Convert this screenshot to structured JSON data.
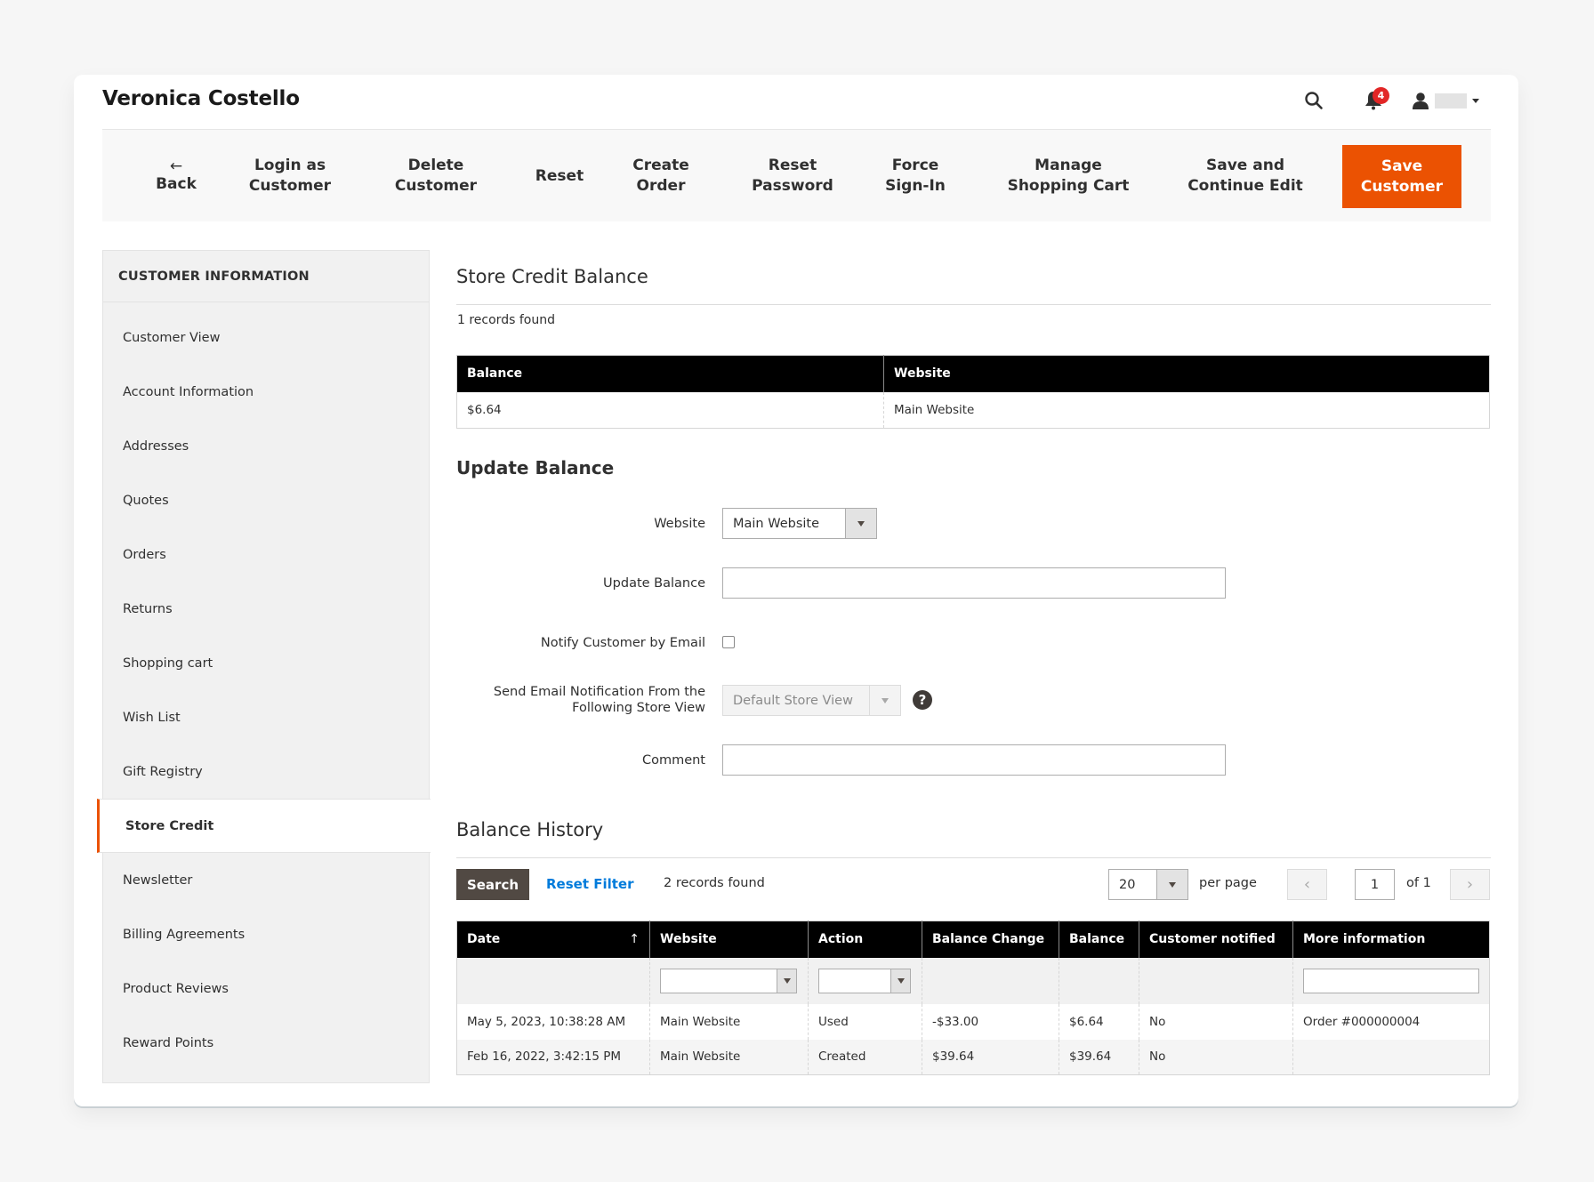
{
  "header": {
    "title": "Veronica Costello",
    "notification_count": "4"
  },
  "toolbar": {
    "back_icon": "←",
    "back_label": "Back",
    "buttons": [
      {
        "line1": "Login as",
        "line2": "Customer"
      },
      {
        "line1": "Delete",
        "line2": "Customer"
      },
      {
        "line1": "Reset",
        "line2": ""
      },
      {
        "line1": "Create",
        "line2": "Order"
      },
      {
        "line1": "Reset",
        "line2": "Password"
      },
      {
        "line1": "Force",
        "line2": "Sign-In"
      },
      {
        "line1": "Manage",
        "line2": "Shopping Cart"
      },
      {
        "line1": "Save and",
        "line2": "Continue Edit"
      }
    ],
    "save": {
      "line1": "Save",
      "line2": "Customer"
    }
  },
  "sidebar": {
    "title": "CUSTOMER INFORMATION",
    "items": [
      {
        "label": "Customer View"
      },
      {
        "label": "Account Information"
      },
      {
        "label": "Addresses"
      },
      {
        "label": "Quotes"
      },
      {
        "label": "Orders"
      },
      {
        "label": "Returns"
      },
      {
        "label": "Shopping cart"
      },
      {
        "label": "Wish List"
      },
      {
        "label": "Gift Registry"
      },
      {
        "label": "Store Credit",
        "active": true
      },
      {
        "label": "Newsletter"
      },
      {
        "label": "Billing Agreements"
      },
      {
        "label": "Product Reviews"
      },
      {
        "label": "Reward Points"
      }
    ]
  },
  "balance": {
    "title": "Store Credit Balance",
    "records": "1 records found",
    "columns": [
      "Balance",
      "Website"
    ],
    "rows": [
      [
        "$6.64",
        "Main Website"
      ]
    ]
  },
  "update": {
    "title": "Update Balance",
    "website_label": "Website",
    "website_value": "Main Website",
    "update_label": "Update Balance",
    "update_value": "",
    "notify_label": "Notify Customer by Email",
    "notify_checked": false,
    "store_view_label_1": "Send Email Notification From the",
    "store_view_label_2": "Following Store View",
    "store_view_value": "Default Store View",
    "help_glyph": "?",
    "comment_label": "Comment",
    "comment_value": ""
  },
  "history": {
    "title": "Balance History",
    "search_label": "Search",
    "reset_filter_label": "Reset Filter",
    "records": "2 records found",
    "per_page_value": "20",
    "per_page_label": "per page",
    "prev_glyph": "‹",
    "next_glyph": "›",
    "page_value": "1",
    "page_of": "of 1",
    "sort_glyph": "↑",
    "columns": [
      "Date",
      "Website",
      "Action",
      "Balance Change",
      "Balance",
      "Customer notified",
      "More information"
    ],
    "rows": [
      [
        "May 5, 2023, 10:38:28 AM",
        "Main Website",
        "Used",
        "-$33.00",
        "$6.64",
        "No",
        "Order #000000004"
      ],
      [
        "Feb 16, 2022, 3:42:15 PM",
        "Main Website",
        "Created",
        "$39.64",
        "$39.64",
        "No",
        ""
      ]
    ]
  },
  "colors": {
    "accent": "#eb5202",
    "link": "#007bdb",
    "badge": "#e22626",
    "header_bg": "#000000"
  }
}
